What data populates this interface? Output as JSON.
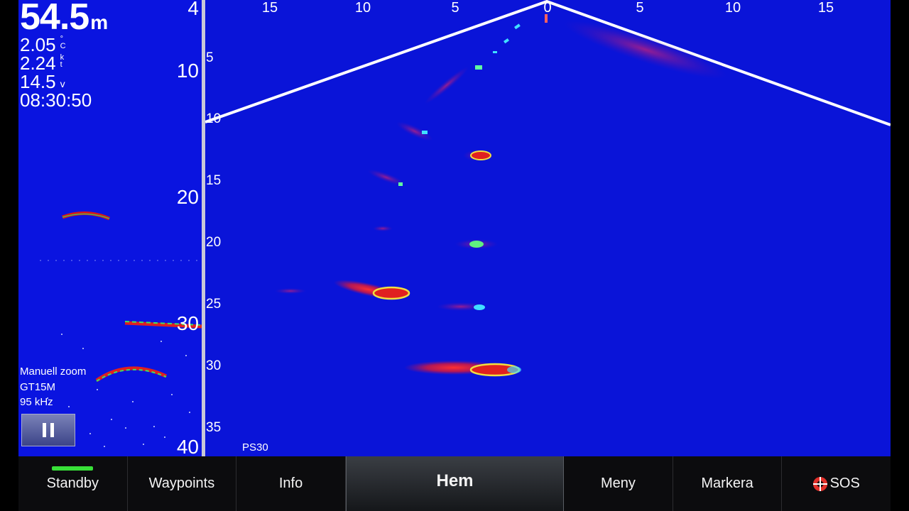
{
  "readouts": {
    "depth_value": "54.5",
    "depth_unit": "m",
    "temperature": "2.05",
    "temperature_unit_top": "°",
    "temperature_unit_bottom": "C",
    "speed": "2.24",
    "speed_unit_top": "k",
    "speed_unit_bottom": "t",
    "voltage": "14.5",
    "voltage_unit": "v",
    "time": "08:30:50"
  },
  "left_scale": [
    "4",
    "10",
    "20",
    "30",
    "40"
  ],
  "left_info": {
    "zoom_mode": "Manuell zoom",
    "transducer": "GT15M",
    "frequency": "95 kHz"
  },
  "panoramic": {
    "top_scale": [
      "15",
      "10",
      "5",
      "0",
      "5",
      "10",
      "15"
    ],
    "depth_scale": [
      "5",
      "10",
      "15",
      "20",
      "25",
      "30",
      "35"
    ],
    "transducer_label": "PS30"
  },
  "bottom_bar": {
    "standby": "Standby",
    "waypoints": "Waypoints",
    "info": "Info",
    "home": "Hem",
    "menu": "Meny",
    "mark": "Markera",
    "sos": "SOS"
  },
  "colors": {
    "sonar_background": "#0a14d8",
    "indicator_green": "#38e038",
    "sos_red": "#e0302a"
  }
}
